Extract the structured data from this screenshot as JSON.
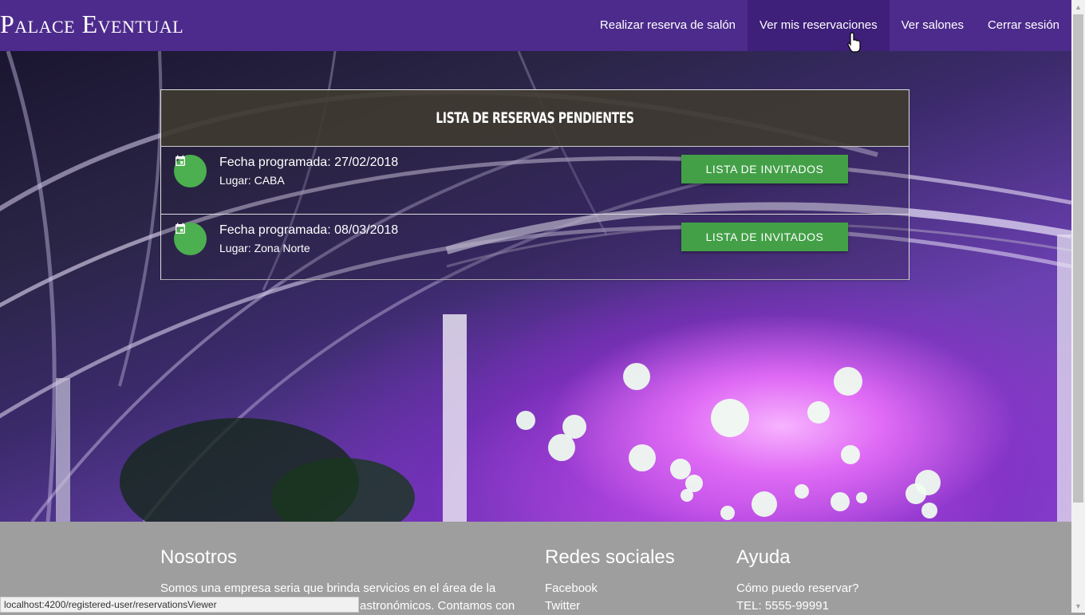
{
  "navbar": {
    "brand": "Palace Eventual",
    "items": [
      {
        "label": "Realizar reserva de salón"
      },
      {
        "label": "Ver mis reservaciones"
      },
      {
        "label": "Ver salones"
      },
      {
        "label": "Cerrar sesión"
      }
    ],
    "active_index": 1,
    "color": "#4d2b8c"
  },
  "reservations": {
    "title": "Lista de reservas pendientes",
    "items": [
      {
        "date": "Fecha programada: 27/02/2018",
        "place": "Lugar: CABA",
        "button_label": "Lista de invitados",
        "icon": "calendar-icon"
      },
      {
        "date": "Fecha programada: 08/03/2018",
        "place": "Lugar: Zona Norte",
        "button_label": "Lista de invitados",
        "icon": "calendar-icon"
      }
    ],
    "accent": "#43a047"
  },
  "footer": {
    "about": {
      "title": "Nosotros",
      "line1": "Somos una empresa seria que brinda servicios en el área de la",
      "line2": "astronómicos. Contamos con"
    },
    "social": {
      "title": "Redes sociales",
      "links": [
        "Facebook",
        "Twitter"
      ]
    },
    "help": {
      "title": "Ayuda",
      "links": [
        "Cómo puedo reservar?",
        "TEL: 5555-99991"
      ]
    }
  },
  "status_bar": {
    "url": "localhost:4200/registered-user/reservationsViewer"
  }
}
